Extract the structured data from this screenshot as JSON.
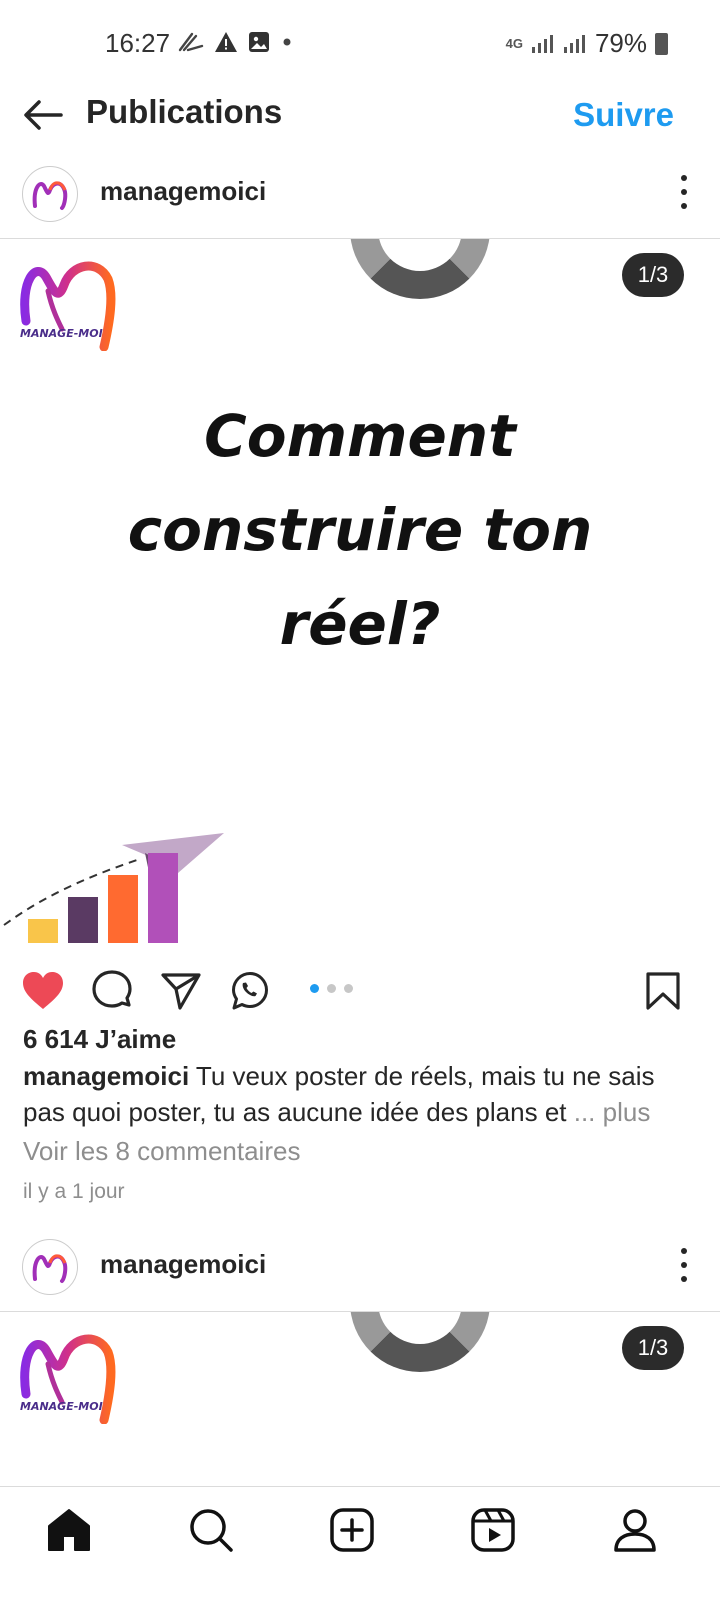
{
  "status_bar": {
    "time": "16:27",
    "network": "4G",
    "battery": "79%"
  },
  "header": {
    "title": "Publications",
    "follow_label": "Suivre"
  },
  "posts": [
    {
      "username": "managemoici",
      "image_counter": "1/3",
      "headline_lines": [
        "Comment",
        "construire ton",
        "réel?"
      ],
      "brand_text": "MANAGE-MOI"
    },
    {
      "username": "managemoici",
      "image_counter": "1/3",
      "brand_text": "MANAGE-MOI"
    }
  ],
  "engagement": {
    "likes": "6 614 J’aime",
    "caption_user": "managemoici",
    "caption_text": " Tu veux poster de réels, mais tu ne sais pas quoi poster, tu as aucune idée des plans et",
    "caption_more": " ... plus",
    "comments_link": "Voir les 8 commentaires",
    "time_ago": "il y a 1 jour",
    "carousel_pages": 3,
    "carousel_active": 1
  },
  "icons": {
    "like": "heart-icon",
    "comment": "comment-icon",
    "share": "send-icon",
    "whatsapp": "whatsapp-icon",
    "save": "bookmark-icon"
  },
  "colors": {
    "accent": "#1e9bf0",
    "like": "#ed4956",
    "bars": [
      "#f9c54a",
      "#5a3a63",
      "#ff6a30",
      "#b150b9"
    ]
  }
}
